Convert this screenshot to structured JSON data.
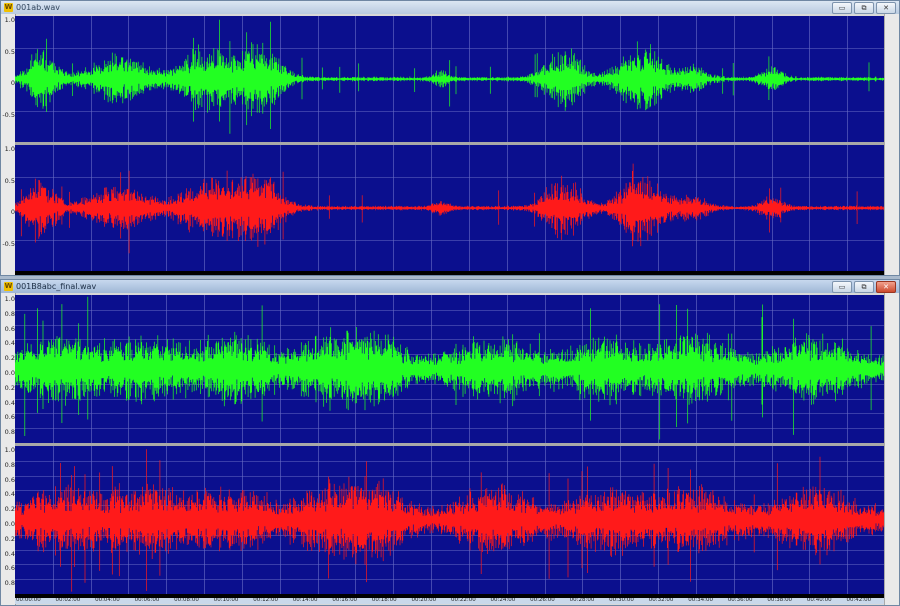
{
  "windows": [
    {
      "title": "001ab.wav",
      "icon_letter": "W",
      "active": false,
      "buttons": {
        "minimize": "▭",
        "restore": "⧉",
        "close": "✕"
      },
      "channels": [
        {
          "name": "left",
          "color": "#22ff22",
          "ticks": [
            "1.0",
            "0.5",
            "0",
            "-0.5"
          ]
        },
        {
          "name": "right",
          "color": "#ff1a1a",
          "ticks": [
            "1.0",
            "0.5",
            "0",
            "-0.5"
          ]
        }
      ]
    },
    {
      "title": "001B8abc_final.wav",
      "icon_letter": "W",
      "active": true,
      "buttons": {
        "minimize": "▭",
        "restore": "⧉",
        "close": "✕"
      },
      "channels": [
        {
          "name": "left",
          "color": "#22ff22",
          "ticks": [
            "1.0",
            "0.8",
            "0.6",
            "0.4",
            "0.2",
            "0.0",
            "0.2",
            "0.4",
            "0.6",
            "0.8"
          ]
        },
        {
          "name": "right",
          "color": "#ff1a1a",
          "ticks": [
            "1.0",
            "0.8",
            "0.6",
            "0.4",
            "0.2",
            "0.0",
            "0.2",
            "0.4",
            "0.6",
            "0.8"
          ]
        }
      ],
      "time_labels": [
        "00:00:00",
        "00:02:00",
        "00:04:00",
        "00:06:00",
        "00:08:00",
        "00:10:00",
        "00:12:00",
        "00:14:00",
        "00:16:00",
        "00:18:00",
        "00:20:00",
        "00:22:00",
        "00:24:00",
        "00:26:00",
        "00:28:00",
        "00:30:00",
        "00:32:00",
        "00:34:00",
        "00:36:00",
        "00:38:00",
        "00:40:00",
        "00:42:00"
      ]
    }
  ]
}
